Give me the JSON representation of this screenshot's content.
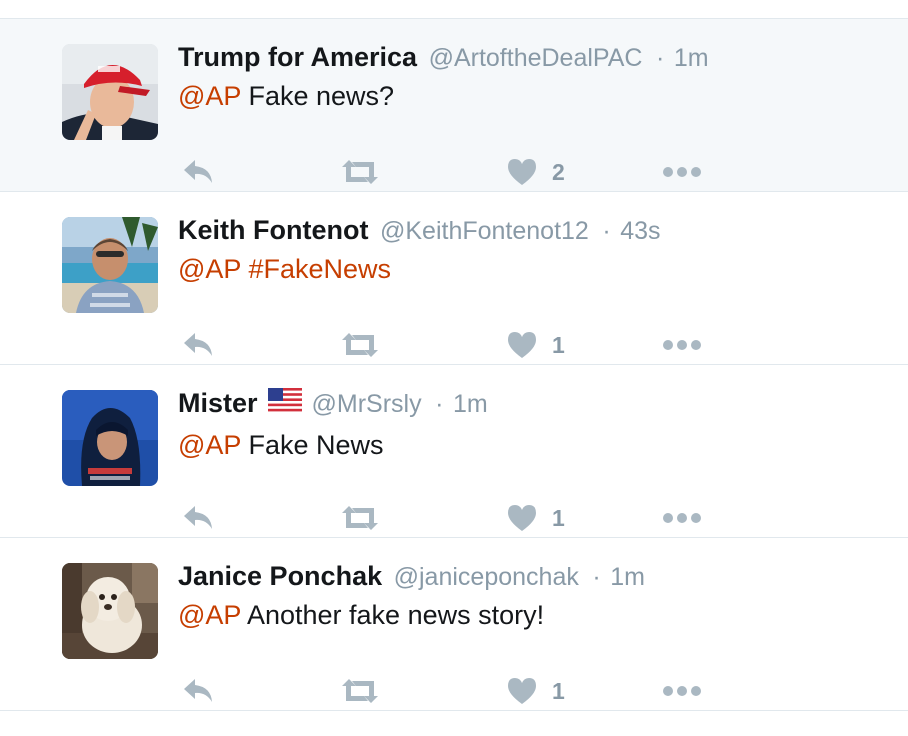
{
  "colors": {
    "link": "#c63e00",
    "meta": "#8899a6",
    "icon": "#aab8c2",
    "highlight_bg": "#f5f8fa",
    "divider": "#e1e8ed"
  },
  "tweets": [
    {
      "fullname": "Trump for America",
      "username": "@ArtoftheDealPAC",
      "separator": "·",
      "time": "1m",
      "mention": "@AP",
      "text": " Fake news?",
      "likes": "2",
      "avatar": "avatar-red-cap"
    },
    {
      "fullname": "Keith Fontenot",
      "username": "@KeithFontenot12",
      "separator": "·",
      "time": "43s",
      "mention": "@AP",
      "hashtag": "#FakeNews",
      "likes": "1",
      "avatar": "avatar-man-pool"
    },
    {
      "fullname": "Mister",
      "flag": "us-flag-emoji",
      "username": "@MrSrsly",
      "separator": "·",
      "time": "1m",
      "mention": "@AP",
      "text": " Fake News",
      "likes": "1",
      "avatar": "avatar-hooded-swimmer"
    },
    {
      "fullname": "Janice Ponchak",
      "username": "@janiceponchak",
      "separator": "·",
      "time": "1m",
      "mention": "@AP",
      "text": " Another fake news story!",
      "likes": "1",
      "avatar": "avatar-dog"
    }
  ]
}
